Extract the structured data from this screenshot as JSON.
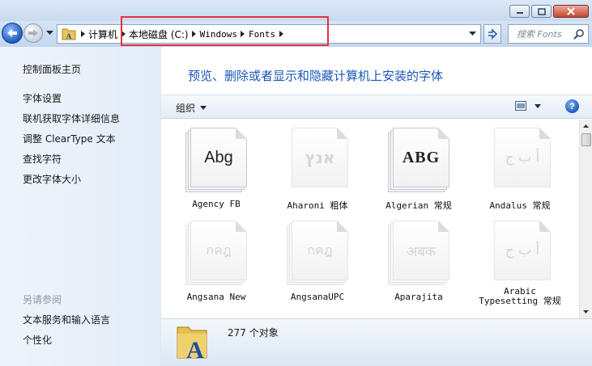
{
  "window": {
    "minimize_icon": "minimize-icon",
    "maximize_icon": "maximize-icon",
    "close_icon": "close-icon"
  },
  "nav": {
    "back_icon": "back-arrow-icon",
    "forward_icon": "forward-arrow-icon",
    "refresh_icon": "refresh-icon"
  },
  "address": {
    "crumbs": [
      "计算机",
      "本地磁盘 (C:)",
      "Windows",
      "Fonts"
    ],
    "search_placeholder": "搜索 Fonts"
  },
  "left_pane": {
    "home": "控制面板主页",
    "links": [
      "字体设置",
      "联机获取字体详细信息",
      "调整 ClearType 文本",
      "查找字符",
      "更改字体大小"
    ],
    "see_also_title": "另请参阅",
    "see_also": [
      "文本服务和输入语言",
      "个性化"
    ]
  },
  "main": {
    "heading": "预览、删除或者显示和隐藏计算机上安装的字体",
    "organize": "组织",
    "help": "?",
    "fonts": [
      {
        "name": "Agency FB",
        "glyph": "Abg",
        "dim": false
      },
      {
        "name": "Aharoni 粗体",
        "glyph": "אנץ",
        "dim": true
      },
      {
        "name": "Algerian 常规",
        "glyph": "ABG",
        "dim": false
      },
      {
        "name": "Andalus 常规",
        "glyph": "أ ب ج",
        "dim": true
      },
      {
        "name": "Angsana New",
        "glyph": "กคฎ",
        "dim": true
      },
      {
        "name": "AngsanaUPC",
        "glyph": "กคฎ",
        "dim": true
      },
      {
        "name": "Aparajita",
        "glyph": "अबक",
        "dim": true
      },
      {
        "name": "Arabic Typesetting 常规",
        "glyph": "أ ب ج",
        "dim": true
      }
    ]
  },
  "details": {
    "count": "277 个对象"
  },
  "colors": {
    "accent_link": "#1a56b8",
    "highlight_box": "#e53240"
  }
}
